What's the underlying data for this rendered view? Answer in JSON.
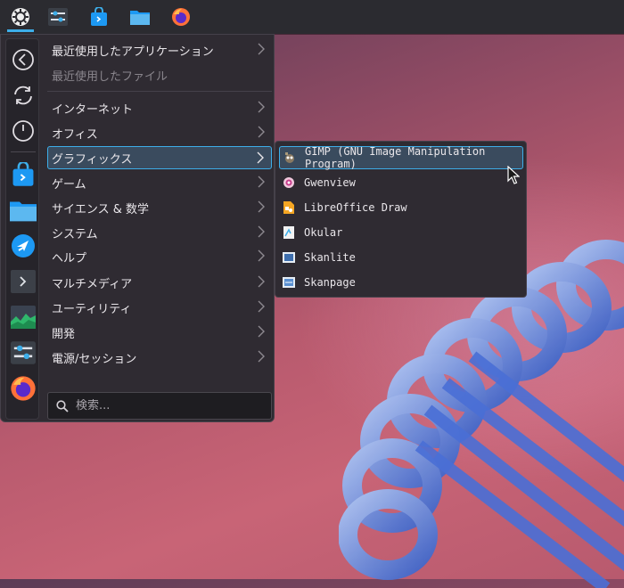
{
  "panel": {
    "items": [
      {
        "name": "application-launcher",
        "icon": "kde-gear-icon"
      },
      {
        "name": "system-settings",
        "icon": "sliders-icon"
      },
      {
        "name": "discover",
        "icon": "store-bag-icon"
      },
      {
        "name": "dolphin",
        "icon": "folder-icon"
      },
      {
        "name": "firefox",
        "icon": "firefox-icon"
      }
    ]
  },
  "favorites": {
    "items": [
      {
        "name": "back",
        "icon": "back-arrow-icon"
      },
      {
        "name": "refresh",
        "icon": "refresh-icon"
      },
      {
        "name": "power",
        "icon": "power-icon"
      },
      {
        "name": "discover",
        "icon": "store-bag-icon"
      },
      {
        "name": "dolphin",
        "icon": "folder-icon"
      },
      {
        "name": "kdeconnect",
        "icon": "kde-bird-icon"
      },
      {
        "name": "konsole",
        "icon": "terminal-icon"
      },
      {
        "name": "ksysguard",
        "icon": "system-monitor-icon"
      },
      {
        "name": "system-settings",
        "icon": "sliders-icon"
      },
      {
        "name": "firefox",
        "icon": "firefox-icon"
      }
    ]
  },
  "categories": [
    {
      "label": "最近使用したアプリケーション",
      "disabled": false
    },
    {
      "label": "最近使用したファイル",
      "disabled": true
    },
    {
      "label": "インターネット",
      "disabled": false
    },
    {
      "label": "オフィス",
      "disabled": false
    },
    {
      "label": "グラフィックス",
      "disabled": false,
      "selected": true
    },
    {
      "label": "ゲーム",
      "disabled": false
    },
    {
      "label": "サイエンス & 数学",
      "disabled": false
    },
    {
      "label": "システム",
      "disabled": false
    },
    {
      "label": "ヘルプ",
      "disabled": false
    },
    {
      "label": "マルチメディア",
      "disabled": false
    },
    {
      "label": "ユーティリティ",
      "disabled": false
    },
    {
      "label": "開発",
      "disabled": false
    },
    {
      "label": "電源/セッション",
      "disabled": false
    }
  ],
  "search": {
    "placeholder": "検索..."
  },
  "submenu": {
    "items": [
      {
        "label": "GIMP (GNU Image Manipulation Program)",
        "icon": "gimp-icon",
        "selected": true
      },
      {
        "label": "Gwenview",
        "icon": "gwenview-icon"
      },
      {
        "label": "LibreOffice Draw",
        "icon": "libreoffice-draw-icon"
      },
      {
        "label": "Okular",
        "icon": "okular-icon"
      },
      {
        "label": "Skanlite",
        "icon": "skanlite-icon"
      },
      {
        "label": "Skanpage",
        "icon": "skanpage-icon"
      }
    ]
  },
  "colors": {
    "accent": "#3daee9",
    "menu_bg": "#2f2b32",
    "panel_bg": "#2b2b30"
  }
}
